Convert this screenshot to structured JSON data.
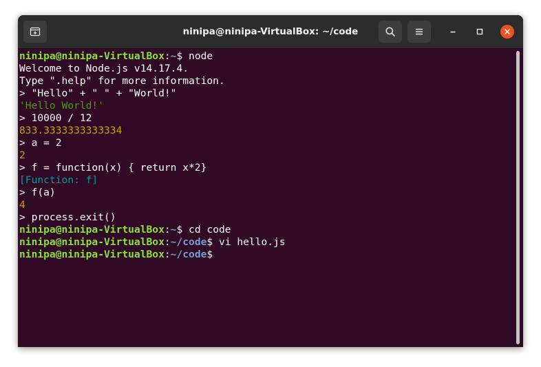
{
  "window": {
    "title": "ninipa@ninipa-VirtualBox: ~/code"
  },
  "icons": {
    "new_tab": "new-tab-icon",
    "search": "search-icon",
    "menu": "hamburger-menu-icon",
    "minimize": "minimize-icon",
    "maximize": "maximize-icon",
    "close": "close-icon"
  },
  "colors": {
    "terminal_bg": "#300a24",
    "titlebar_bg": "#2c2c2c",
    "prompt_user": "#8ae234",
    "prompt_path": "#729fcf",
    "string_output": "#4e9a06",
    "number_output": "#c4a000",
    "function_output": "#06989a",
    "close_button": "#e95420"
  },
  "prompt": {
    "user_host": "ninipa@ninipa-VirtualBox",
    "colon": ":",
    "home_path": "~",
    "code_path": "~/code",
    "dollar": "$"
  },
  "terminal": {
    "cmd_node": " node",
    "welcome": "Welcome to Node.js v14.17.4.",
    "help_hint": "Type \".help\" for more information.",
    "repl_1": "> \"Hello\" + \" \" + \"World!\"",
    "out_1": "'Hello World!'",
    "repl_2": "> 10000 / 12",
    "out_2": "833.3333333333334",
    "repl_3": "> a = 2",
    "out_3": "2",
    "repl_4": "> f = function(x) { return x*2}",
    "out_4": "[Function: f]",
    "repl_5": "> f(a)",
    "out_5": "4",
    "repl_6": "> process.exit()",
    "cmd_cd": " cd code",
    "cmd_vi": " vi hello.js"
  }
}
